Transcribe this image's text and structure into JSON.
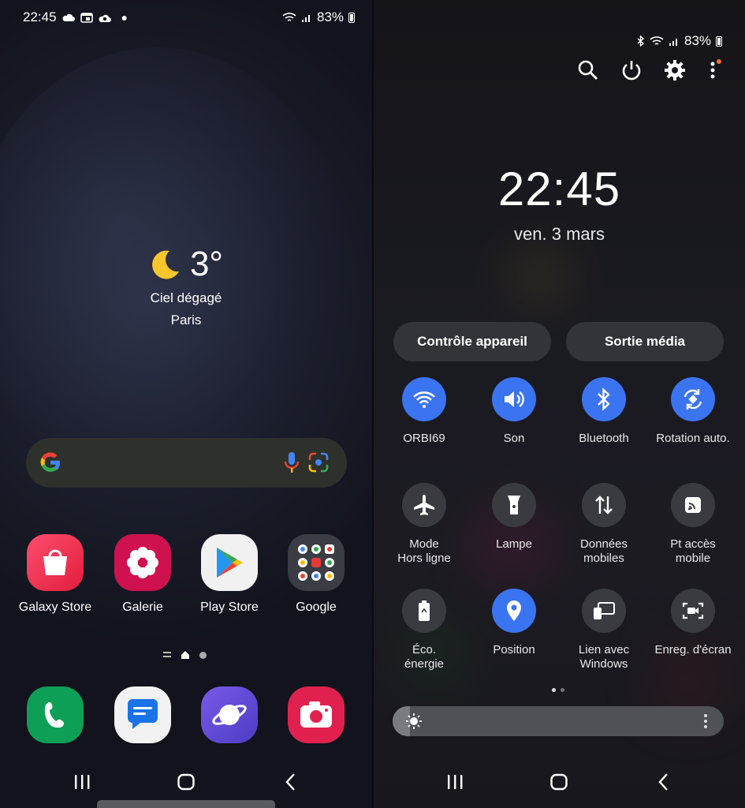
{
  "home": {
    "status": {
      "time": "22:45",
      "battery": "83%"
    },
    "weather": {
      "temperature": "3°",
      "condition": "Ciel dégagé",
      "city": "Paris"
    },
    "apps": [
      {
        "label": "Galaxy Store",
        "icon": "galaxy-store-icon"
      },
      {
        "label": "Galerie",
        "icon": "gallery-icon"
      },
      {
        "label": "Play Store",
        "icon": "play-store-icon"
      },
      {
        "label": "Google",
        "icon": "google-folder-icon"
      }
    ],
    "dock": [
      {
        "icon": "phone-icon"
      },
      {
        "icon": "messages-icon"
      },
      {
        "icon": "internet-icon"
      },
      {
        "icon": "camera-icon"
      }
    ]
  },
  "panel": {
    "status": {
      "battery": "83%"
    },
    "clock": "22:45",
    "date": "ven. 3 mars",
    "buttons": {
      "device_control": "Contrôle appareil",
      "media_output": "Sortie média"
    },
    "tiles": [
      {
        "label": "ORBI69",
        "icon": "wifi-icon",
        "on": true
      },
      {
        "label": "Son",
        "icon": "sound-icon",
        "on": true
      },
      {
        "label": "Bluetooth",
        "icon": "bluetooth-icon",
        "on": true
      },
      {
        "label": "Rotation auto.",
        "icon": "rotation-icon",
        "on": true
      },
      {
        "label": "Mode\nHors ligne",
        "icon": "airplane-icon",
        "on": false
      },
      {
        "label": "Lampe",
        "icon": "flashlight-icon",
        "on": false
      },
      {
        "label": "Données\nmobiles",
        "icon": "mobile-data-icon",
        "on": false
      },
      {
        "label": "Pt accès\nmobile",
        "icon": "hotspot-icon",
        "on": false
      },
      {
        "label": "Éco.\nénergie",
        "icon": "power-saving-icon",
        "on": false
      },
      {
        "label": "Position",
        "icon": "location-icon",
        "on": true
      },
      {
        "label": "Lien avec\nWindows",
        "icon": "link-to-windows-icon",
        "on": false
      },
      {
        "label": "Enreg. d'écran",
        "icon": "screen-recorder-icon",
        "on": false
      }
    ],
    "brightness_fraction": 0.05
  },
  "colors": {
    "accent": "#3b74f0"
  }
}
